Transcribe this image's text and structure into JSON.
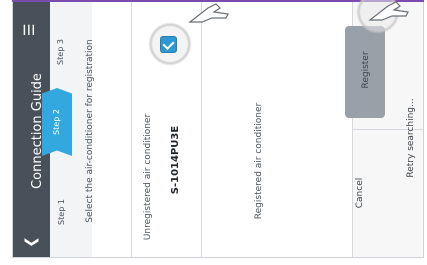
{
  "header": {
    "title": "Connection Guide",
    "back_icon": "chevron-left-icon",
    "menu_icon": "hamburger-menu-icon"
  },
  "steps": {
    "step1": "Step 1",
    "step2": "Step 2",
    "step3": "Step 3",
    "active": 2
  },
  "content": {
    "instruction": "Select the air-conditioner for registration",
    "unregistered_label": "Unregistered air conditioner",
    "unit_model": "S-1014PU3E",
    "registered_label": "Registered air conditioner"
  },
  "actions": {
    "register": "Register",
    "cancel": "Cancel",
    "retry": "Retry searching..."
  },
  "colors": {
    "appbar": "#4a5059",
    "accent": "#33a8de",
    "checkbox": "#2f97d2",
    "register_button": "#9aa0a8"
  }
}
